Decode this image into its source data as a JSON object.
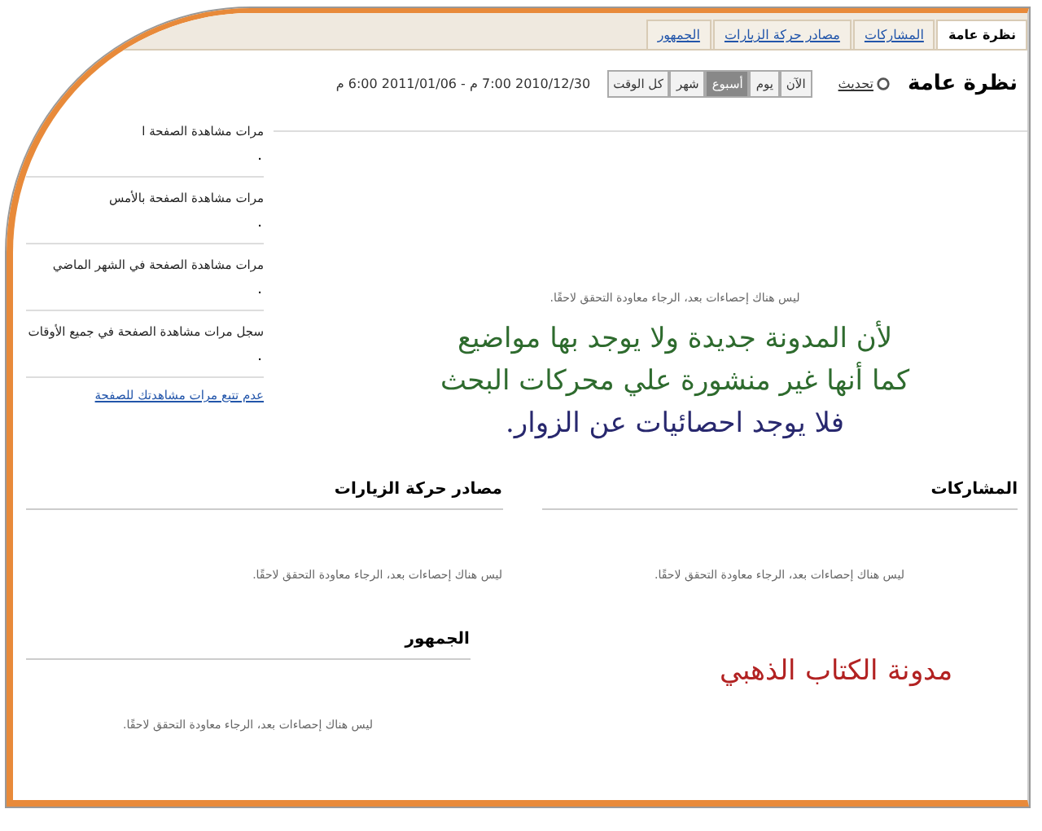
{
  "tabs": [
    {
      "label": "نظرة عامة",
      "selected": true
    },
    {
      "label": "المشاركات",
      "selected": false
    },
    {
      "label": "مصادر حركة الزيارات",
      "selected": false
    },
    {
      "label": "الجمهور",
      "selected": false
    }
  ],
  "header": {
    "title": "نظرة عامة",
    "refresh": "تحديث",
    "ranges": [
      {
        "label": "الآن",
        "selected": false
      },
      {
        "label": "يوم",
        "selected": false
      },
      {
        "label": "أسبوع",
        "selected": true
      },
      {
        "label": "شهر",
        "selected": false
      },
      {
        "label": "كل الوقت",
        "selected": false
      }
    ],
    "date_range": "2010/12/30 7:00 م - 2011/01/06 6:00 م"
  },
  "stats": [
    {
      "label": "مرات مشاهدة الصفحة ا",
      "value": "٠"
    },
    {
      "label": "مرات مشاهدة الصفحة بالأمس",
      "value": "٠"
    },
    {
      "label": "مرات مشاهدة الصفحة في الشهر الماضي",
      "value": "٠"
    },
    {
      "label": "سجل مرات مشاهدة الصفحة في جميع الأوقات",
      "value": "٠"
    }
  ],
  "stats_link": "عدم تتبع مرات مشاهدتك للصفحة",
  "main_message": "ليس هناك إحصاءات بعد، الرجاء معاودة التحقق لاحقًا.",
  "note_lines": [
    {
      "text": "لأن المدونة جديدة ولا يوجد بها مواضيع",
      "color": "#2e6b2e"
    },
    {
      "text": "كما أنها غير منشورة علي محركات البحث",
      "color": "#2e6b2e"
    },
    {
      "text": "فلا يوجد احصائيات عن الزوار.",
      "color": "#28286e"
    }
  ],
  "sections": [
    {
      "title": "المشاركات",
      "message": "ليس هناك إحصاءات بعد، الرجاء معاودة التحقق لاحقًا."
    },
    {
      "title": "مصادر حركة الزيارات",
      "message": "ليس هناك إحصاءات بعد، الرجاء معاودة التحقق لاحقًا."
    }
  ],
  "audience": {
    "title": "الجمهور",
    "message": "ليس هناك إحصاءات بعد، الرجاء معاودة التحقق لاحقًا."
  },
  "signature": "مدونة الكتاب الذهبي"
}
